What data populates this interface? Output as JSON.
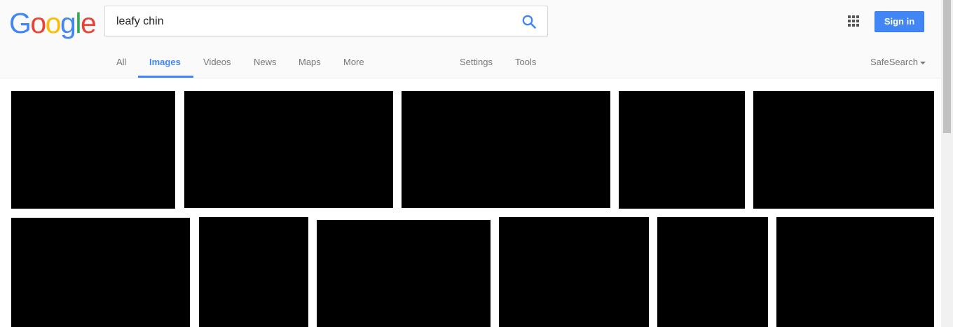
{
  "logo": {
    "letters": [
      "G",
      "o",
      "o",
      "g",
      "l",
      "e"
    ],
    "colors": [
      "#4285f4",
      "#ea4335",
      "#fbbc05",
      "#4285f4",
      "#34a853",
      "#ea4335"
    ]
  },
  "search": {
    "value": "leafy chin",
    "icon": "search-icon",
    "icon_color": "#4285f4"
  },
  "header": {
    "apps_icon": "apps-grid-icon",
    "signin_label": "Sign in",
    "signin_color": "#4285f4"
  },
  "tabs": [
    "All",
    "Images",
    "Videos",
    "News",
    "Maps",
    "More"
  ],
  "active_tab": "Images",
  "tools": {
    "settings": "Settings",
    "tools": "Tools",
    "safesearch": "SafeSearch"
  },
  "results": {
    "row_1_count": 5,
    "row_2_count": 6
  }
}
